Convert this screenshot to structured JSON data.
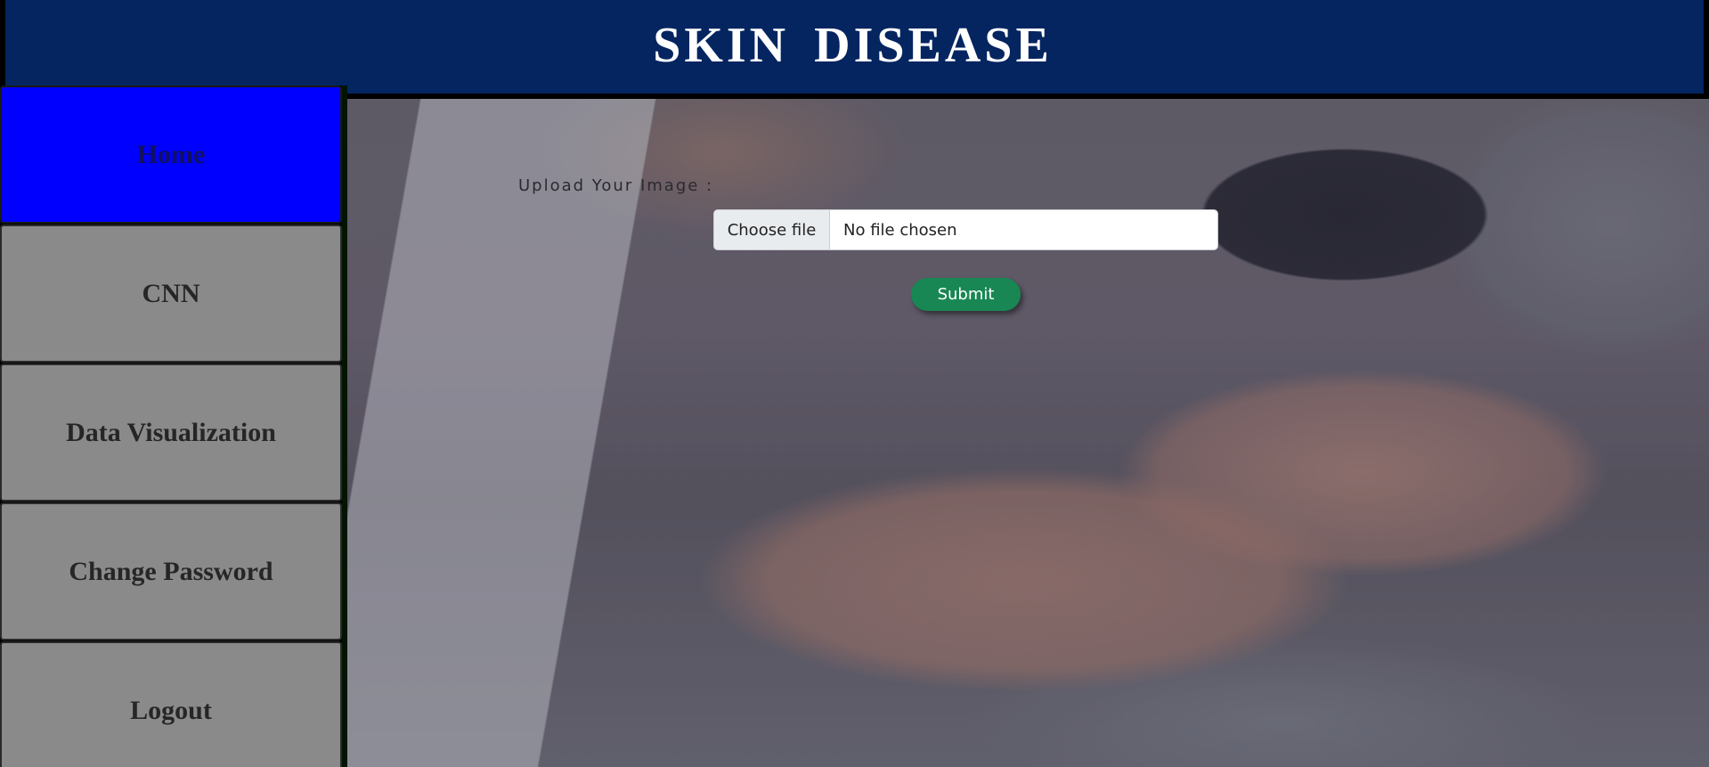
{
  "header": {
    "title": "SKIN DISEASE"
  },
  "sidebar": {
    "items": [
      {
        "label": "Home",
        "active": true
      },
      {
        "label": "CNN"
      },
      {
        "label": "Data Visualization"
      },
      {
        "label": "Change Password"
      },
      {
        "label": "Logout"
      }
    ]
  },
  "upload": {
    "label": "Upload Your Image :",
    "choose_file_label": "Choose file",
    "file_status": "No file chosen",
    "submit_label": "Submit"
  },
  "colors": {
    "header_bg": "#042560",
    "active_nav": "#0000ff",
    "nav_bg": "#8a8a8a",
    "submit_bg": "#198754"
  }
}
